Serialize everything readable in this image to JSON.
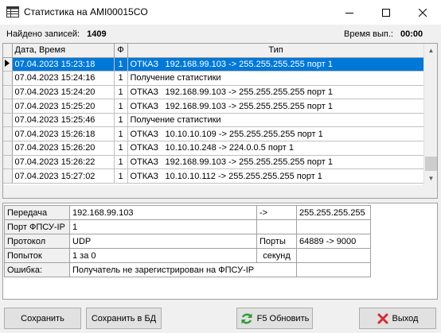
{
  "window": {
    "title": "Статистика на AMI00015CO"
  },
  "stats": {
    "found_label": "Найдено записей:",
    "found_value": "1409",
    "time_label": "Время вып.:",
    "time_value": "00:00"
  },
  "grid": {
    "columns": [
      "Дата, Время",
      "Ф",
      "Тип"
    ],
    "rows": [
      {
        "datetime": "07.04.2023 15:23:18",
        "f": "1",
        "kind": "ОТКАЗ",
        "detail": "192.168.99.103 -> 255.255.255.255 порт 1"
      },
      {
        "datetime": "07.04.2023 15:24:16",
        "f": "1",
        "kind": "Получение статистики",
        "detail": ""
      },
      {
        "datetime": "07.04.2023 15:24:20",
        "f": "1",
        "kind": "ОТКАЗ",
        "detail": "192.168.99.103 -> 255.255.255.255 порт 1"
      },
      {
        "datetime": "07.04.2023 15:25:20",
        "f": "1",
        "kind": "ОТКАЗ",
        "detail": "192.168.99.103 -> 255.255.255.255 порт 1"
      },
      {
        "datetime": "07.04.2023 15:25:46",
        "f": "1",
        "kind": "Получение статистики",
        "detail": ""
      },
      {
        "datetime": "07.04.2023 15:26:18",
        "f": "1",
        "kind": "ОТКАЗ",
        "detail": "10.10.10.109 -> 255.255.255.255 порт 1"
      },
      {
        "datetime": "07.04.2023 15:26:20",
        "f": "1",
        "kind": "ОТКАЗ",
        "detail": "10.10.10.248 -> 224.0.0.5 порт 1"
      },
      {
        "datetime": "07.04.2023 15:26:22",
        "f": "1",
        "kind": "ОТКАЗ",
        "detail": "192.168.99.103 -> 255.255.255.255 порт 1"
      },
      {
        "datetime": "07.04.2023 15:27:02",
        "f": "1",
        "kind": "ОТКАЗ",
        "detail": "10.10.10.112 -> 255.255.255.255 порт 1"
      }
    ]
  },
  "detail": {
    "transfer_label": "Передача",
    "transfer_src": "192.168.99.103",
    "transfer_arrow": "->",
    "transfer_dst": "255.255.255.255",
    "port_label": "Порт ФПСУ-IP",
    "port_value": "1",
    "protocol_label": "Протокол",
    "protocol_value": "UDP",
    "ports_label": "Порты",
    "ports_value": "64889 -> 9000",
    "attempts_label": "Попыток",
    "attempts_value": "1 за 0",
    "seconds_label": "секунд",
    "error_label": "Ошибка:",
    "error_value": "Получатель не зарегистрирован на ФПСУ-IP"
  },
  "buttons": {
    "save": "Сохранить",
    "save_db": "Сохранить в БД",
    "refresh": "F5  Обновить",
    "exit": "Выход"
  },
  "colors": {
    "selection": "#0078d7",
    "refresh_icon": "#2e9a35",
    "exit_icon": "#d32f2f"
  },
  "icons": {
    "app": "table-grid-icon",
    "minimize": "minimize-icon",
    "maximize": "maximize-icon",
    "close": "close-icon",
    "row_pointer": "row-pointer-icon",
    "refresh": "refresh-icon",
    "exit": "exit-x-icon"
  }
}
